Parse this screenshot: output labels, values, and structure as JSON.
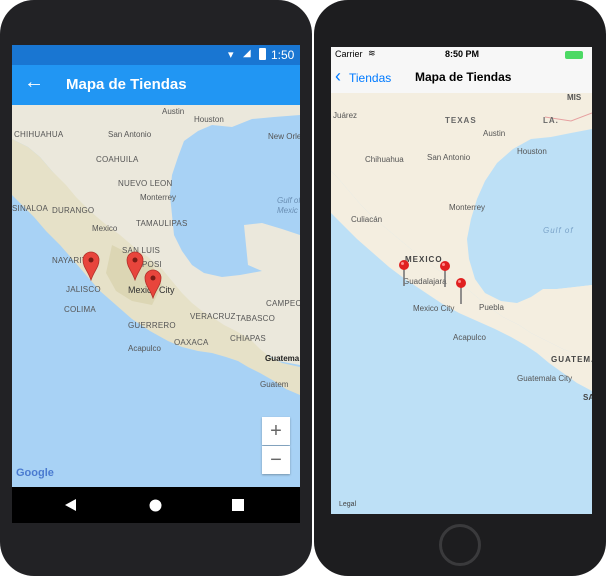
{
  "android": {
    "status": {
      "time": "1:50"
    },
    "appbar": {
      "back": "←",
      "title": "Mapa de Tiendas"
    },
    "map": {
      "labels": {
        "austin": "Austin",
        "houston": "Houston",
        "san_antonio": "San Antonio",
        "new_orleans": "New Orle",
        "chihuahua": "CHIHUAHUA",
        "coahuila": "COAHUILA",
        "nuevo_leon": "NUEVO LEON",
        "monterrey": "Monterrey",
        "sinaloa": "SINALOA",
        "durango": "DURANGO",
        "tamaulipas": "TAMAULIPAS",
        "mexico": "Mexico",
        "gulf": "Gulf of",
        "gulf2": "Mexic",
        "nayarit": "NAYARIT",
        "san_luis": "SAN LUIS",
        "potosi": "POSI",
        "jalisco": "JALISCO",
        "mexico_city": "Mexico City",
        "colima": "COLIMA",
        "veracruz": "VERACRUZ",
        "tabasco": "TABASCO",
        "campeche": "CAMPEC",
        "guerrero": "GUERRERO",
        "oaxaca": "OAXACA",
        "chiapas": "CHIAPAS",
        "acapulco": "Acapulco",
        "guatemala": "Guatema",
        "guatemala2": "Guatem"
      },
      "zoom_in": "+",
      "zoom_out": "−",
      "logo": "Google"
    }
  },
  "ios": {
    "status": {
      "carrier": "Carrier",
      "time": "8:50 PM"
    },
    "nav": {
      "back": "Tiendas",
      "title": "Mapa de Tiendas"
    },
    "map": {
      "labels": {
        "mis": "MIS",
        "juarez": "Juárez",
        "texas": "TEXAS",
        "la": "LA.",
        "austin": "Austin",
        "houston": "Houston",
        "chihuahua": "Chihuahua",
        "san_antonio": "San Antonio",
        "monterrey": "Monterrey",
        "culiacan": "Culiacán",
        "gulf": "Gulf of",
        "mexico": "MEXICO",
        "guadalajara": "Guadalajara",
        "mexico_city": "Mexico City",
        "puebla": "Puebla",
        "acapulco": "Acapulco",
        "guatemala": "GUATEMA",
        "guatemala_city": "Guatemala City",
        "sa": "SA",
        "legal": "Legal"
      }
    }
  }
}
